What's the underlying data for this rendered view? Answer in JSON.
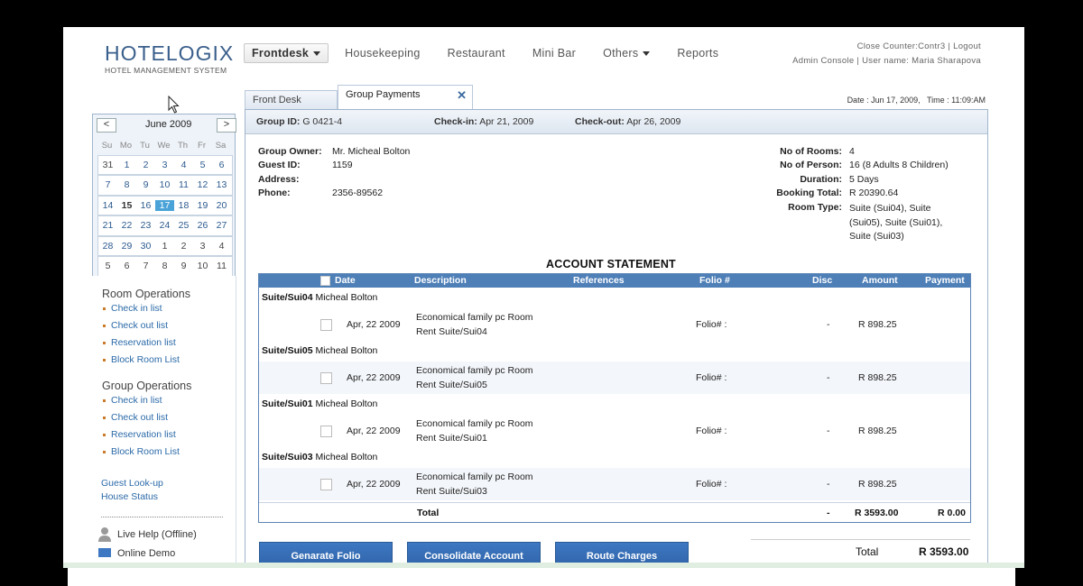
{
  "header": {
    "logo_main": "HOTELOGIX",
    "logo_sub": "HOTEL MANAGEMENT SYSTEM",
    "nav": [
      "Frontdesk",
      "Housekeeping",
      "Restaurant",
      "Mini Bar",
      "Others",
      "Reports"
    ],
    "close_counter": "Close Counter:Contr3",
    "logout": "Logout",
    "admin_console": "Admin Console",
    "user": "User name: Maria Sharapova"
  },
  "tabs": {
    "front_desk": "Front Desk",
    "group_payments": "Group Payments"
  },
  "datetime": {
    "date": "Date : Jun 17, 2009,",
    "time": "Time : 11:09:AM"
  },
  "calendar": {
    "title": "June 2009",
    "prev": "<",
    "next": ">",
    "dows": [
      "Su",
      "Mo",
      "Tu",
      "We",
      "Th",
      "Fr",
      "Sa"
    ],
    "weeks": [
      [
        "31",
        "1",
        "2",
        "3",
        "4",
        "5",
        "6"
      ],
      [
        "7",
        "8",
        "9",
        "10",
        "11",
        "12",
        "13"
      ],
      [
        "14",
        "15",
        "16",
        "17",
        "18",
        "19",
        "20"
      ],
      [
        "21",
        "22",
        "23",
        "24",
        "25",
        "26",
        "27"
      ],
      [
        "28",
        "29",
        "30",
        "1",
        "2",
        "3",
        "4"
      ],
      [
        "5",
        "6",
        "7",
        "8",
        "9",
        "10",
        "11"
      ]
    ],
    "selected": "17"
  },
  "sidebar": {
    "room_ops_title": "Room Operations",
    "room_ops": [
      "Check in list",
      "Check out list",
      "Reservation list",
      "Block Room List"
    ],
    "group_ops_title": "Group Operations",
    "group_ops": [
      "Check in list",
      "Check out list",
      "Reservation list",
      "Block Room List"
    ],
    "guest_lookup": "Guest Look-up",
    "house_status": "House Status",
    "live_help": "Live Help (Offline)",
    "online_demo": "Online Demo"
  },
  "group": {
    "id_label": "Group ID:",
    "id": "G 0421-4",
    "checkin_label": "Check-in:",
    "checkin": "Apr 21, 2009",
    "checkout_label": "Check-out:",
    "checkout": "Apr 26, 2009"
  },
  "owner": {
    "owner_label": "Group Owner:",
    "owner": "Mr. Micheal Bolton",
    "guest_id_label": "Guest ID:",
    "guest_id": "1159",
    "address_label": "Address:",
    "address": "",
    "phone_label": "Phone:",
    "phone": "2356-89562"
  },
  "summary": {
    "rooms_label": "No of Rooms:",
    "rooms": "4",
    "persons_label": "No of Person:",
    "persons": "16 (8 Adults 8 Children)",
    "duration_label": "Duration:",
    "duration": "5 Days",
    "booking_total_label": "Booking Total:",
    "booking_total": "R 20390.64",
    "room_type_label": "Room Type:",
    "room_type_lines": [
      "Suite (Sui04), Suite",
      "(Sui05), Suite (Sui01),",
      "Suite (Sui03)"
    ]
  },
  "statement": {
    "title": "ACCOUNT STATEMENT",
    "columns": [
      "Date",
      "Description",
      "References",
      "Folio #",
      "Disc",
      "Amount",
      "Payment"
    ],
    "groups": [
      {
        "room": "Suite/Sui04",
        "guest": "Micheal Bolton",
        "date": "Apr, 22 2009",
        "desc1": "Economical family pc Room",
        "desc2": "Rent Suite/Sui04",
        "folio": "Folio# :",
        "disc": "-",
        "amount": "R 898.25"
      },
      {
        "room": "Suite/Sui05",
        "guest": "Micheal Bolton",
        "date": "Apr, 22 2009",
        "desc1": "Economical family pc Room",
        "desc2": "Rent Suite/Sui05",
        "folio": "Folio# :",
        "disc": "-",
        "amount": "R 898.25"
      },
      {
        "room": "Suite/Sui01",
        "guest": "Micheal Bolton",
        "date": "Apr, 22 2009",
        "desc1": "Economical family pc Room",
        "desc2": "Rent Suite/Sui01",
        "folio": "Folio# :",
        "disc": "-",
        "amount": "R 898.25"
      },
      {
        "room": "Suite/Sui03",
        "guest": "Micheal Bolton",
        "date": "Apr, 22 2009",
        "desc1": "Economical family pc Room",
        "desc2": "Rent Suite/Sui03",
        "folio": "Folio# :",
        "disc": "-",
        "amount": "R 898.25"
      }
    ],
    "total_label": "Total",
    "total_disc": "-",
    "total_amount": "R 3593.00",
    "total_payment": "R 0.00"
  },
  "actions": {
    "generate_folio": "Genarate Folio",
    "consolidate": "Consolidate Account",
    "route_charges": "Route Charges"
  },
  "grand_total": {
    "label": "Total",
    "value": "R 3593.00"
  }
}
